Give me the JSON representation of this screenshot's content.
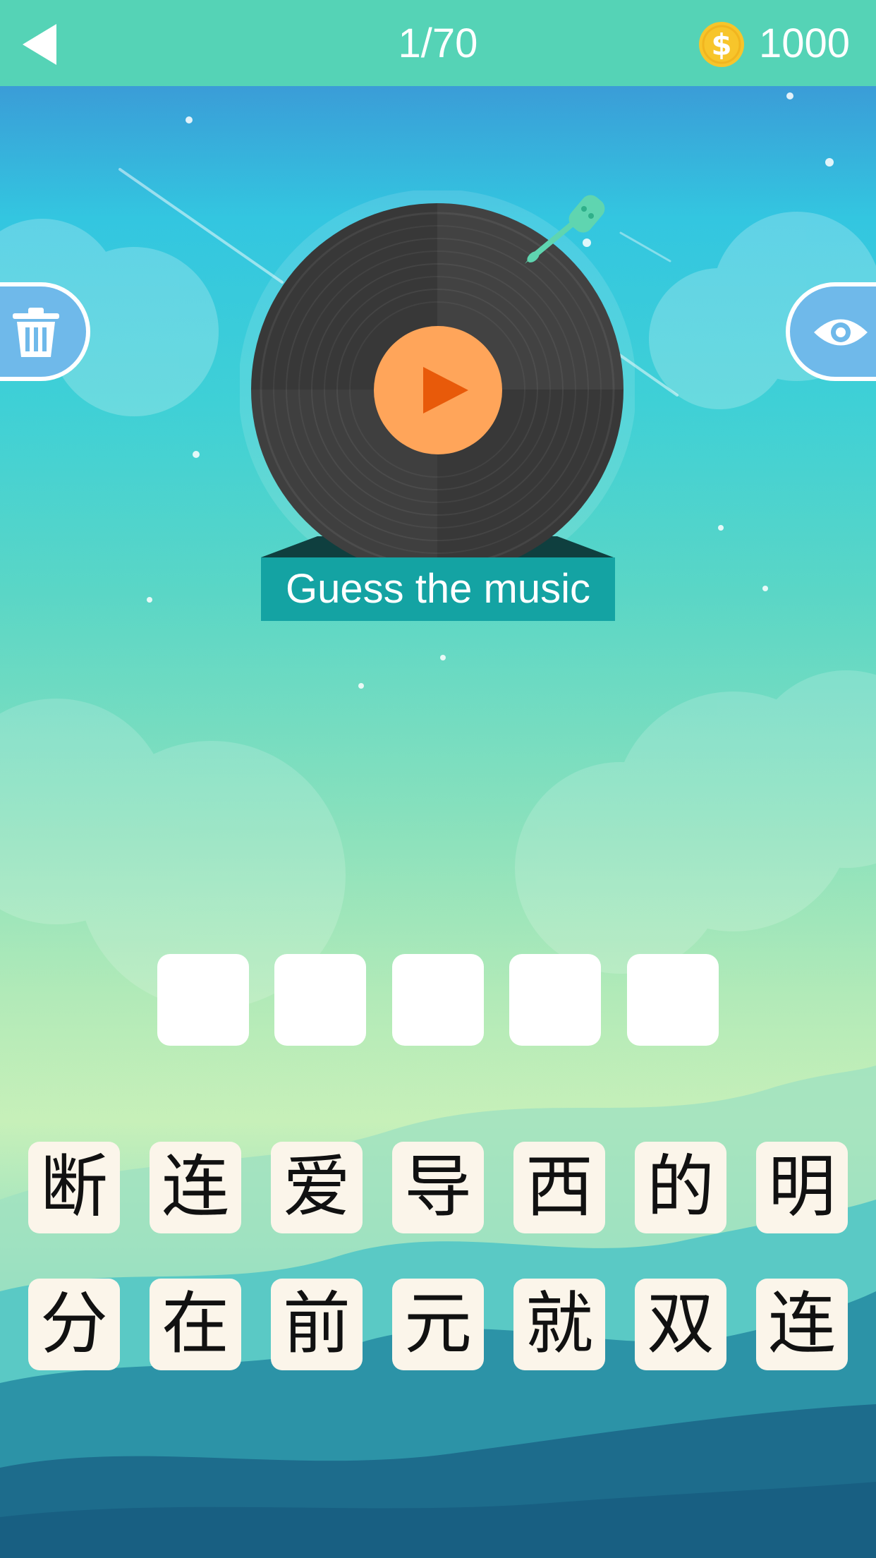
{
  "header": {
    "back_icon": "back-triangle-icon",
    "level": "1/70",
    "coin_icon": "dollar-coin-icon",
    "coins": "1000"
  },
  "side_buttons": {
    "left_icon": "trash-icon",
    "right_icon": "eye-icon"
  },
  "record": {
    "play_icon": "play-icon",
    "label": "Guess the music"
  },
  "answer_slots": [
    "",
    "",
    "",
    "",
    ""
  ],
  "letter_tiles": {
    "row1": [
      "断",
      "连",
      "爱",
      "导",
      "西",
      "的",
      "明"
    ],
    "row2": [
      "分",
      "在",
      "前",
      "元",
      "就",
      "双",
      "连"
    ]
  },
  "colors": {
    "header": "#55d3b6",
    "coin": "#f7c52b",
    "play_button": "#ffa55a",
    "play_triangle": "#e85a0a",
    "label_bg": "#14a3a3",
    "tile_bg": "#fbf5ea",
    "side_button": "#6fb9ea"
  }
}
